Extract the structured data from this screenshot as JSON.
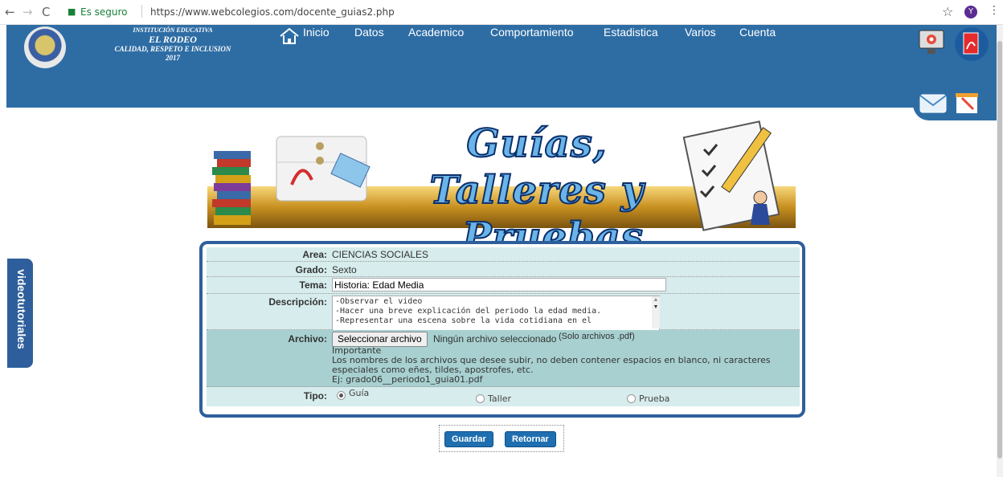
{
  "browser": {
    "secure_label": "Es seguro",
    "url": "https://www.webcolegios.com/docente_guias2.php",
    "profile_initial": "Y"
  },
  "school": {
    "line1": "INSTITUCIÓN EDUCATIVA",
    "line2": "EL RODEO",
    "line3": "CALIDAD, RESPETO E INCLUSION",
    "line4": "2017"
  },
  "menu": {
    "items": [
      "Inicio",
      "Datos",
      "Academico",
      "Comportamiento",
      "Estadistica",
      "Varios",
      "Cuenta"
    ]
  },
  "sidetab": {
    "label": "videotutoriales"
  },
  "banner": {
    "title_line1": "Guías, Talleres y",
    "title_line2": "Pruebas"
  },
  "form": {
    "area_label": "Area:",
    "area_value": "CIENCIAS SOCIALES",
    "grado_label": "Grado:",
    "grado_value": "Sexto",
    "tema_label": "Tema:",
    "tema_value": "Historia: Edad Media",
    "descripcion_label": "Descripción:",
    "descripcion_lines": [
      "-Observar el video",
      "-Hacer una breve explicación del periodo la edad media.",
      "-Representar una escena sobre la vida cotidiana en el"
    ],
    "archivo_label": "Archivo:",
    "file_button": "Seleccionar archivo",
    "file_status": "Ningún archivo seleccionado",
    "file_hint": "(Solo archivos .pdf)",
    "note_title": "Importante",
    "note_line1": "Los nombres de los archivos que desee subir, no deben contener espacios en blanco, ni caracteres",
    "note_line2": "especiales como eñes, tildes, apostrofes, etc.",
    "note_line3": "Ej: grado06__periodo1_guia01.pdf",
    "tipo_label": "Tipo:",
    "tipo_options": [
      "Guía",
      "Taller",
      "Prueba"
    ],
    "tipo_selected": "Guía"
  },
  "buttons": {
    "save": "Guardar",
    "back": "Retornar"
  },
  "colors": {
    "header": "#2e6da4",
    "row": "#d7ecec",
    "archivo_row": "#a8d0d0",
    "button": "#1f6fb0"
  }
}
